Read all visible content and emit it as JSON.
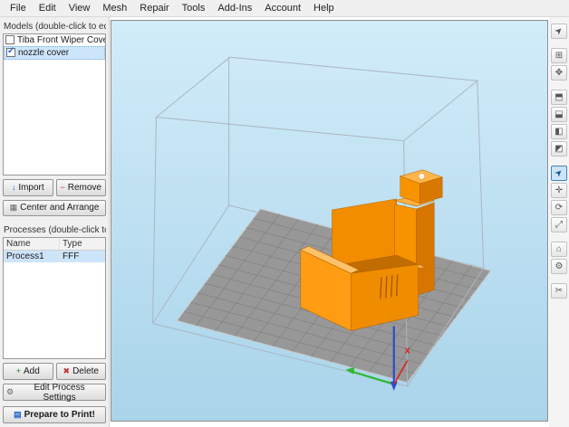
{
  "menu": {
    "items": [
      "File",
      "Edit",
      "View",
      "Mesh",
      "Repair",
      "Tools",
      "Add-Ins",
      "Account",
      "Help"
    ]
  },
  "models_panel": {
    "title": "Models (double-click to edit)",
    "items": [
      {
        "label": "Tiba Front Wiper Cover.STL",
        "checked": false,
        "selected": false
      },
      {
        "label": "nozzle cover",
        "checked": true,
        "selected": true
      }
    ],
    "import_label": "Import",
    "remove_label": "Remove",
    "center_arrange_label": "Center and Arrange"
  },
  "processes_panel": {
    "title": "Processes (double-click to edit)",
    "columns": [
      "Name",
      "Type"
    ],
    "rows": [
      {
        "name": "Process1",
        "type": "FFF"
      }
    ],
    "add_label": "Add",
    "delete_label": "Delete",
    "edit_settings_label": "Edit Process Settings",
    "prepare_label": "Prepare to Print!"
  },
  "viewport": {
    "axis_x_label": "x"
  },
  "toolbar": {
    "icons": [
      {
        "name": "select-arrow-icon",
        "glyph": "➤"
      },
      {
        "name": "fit-view-icon",
        "glyph": "⊞"
      },
      {
        "name": "pan-view-icon",
        "glyph": "✥"
      },
      {
        "name": "cube-top-view-icon",
        "glyph": "⬒"
      },
      {
        "name": "cube-front-view-icon",
        "glyph": "⬓"
      },
      {
        "name": "cube-side-view-icon",
        "glyph": "◧"
      },
      {
        "name": "cube-iso-view-icon",
        "glyph": "◩"
      },
      {
        "name": "cursor-tool-icon",
        "glyph": "➤"
      },
      {
        "name": "move-tool-icon",
        "glyph": "✛"
      },
      {
        "name": "rotate-tool-icon",
        "glyph": "⟳"
      },
      {
        "name": "scale-tool-icon",
        "glyph": "⤢"
      },
      {
        "name": "support-tool-icon",
        "glyph": "⌂"
      },
      {
        "name": "settings-gear-icon",
        "glyph": "⚙"
      },
      {
        "name": "cross-section-icon",
        "glyph": "✂"
      }
    ]
  },
  "colors": {
    "model_orange": "#f79200",
    "plate_gray": "#979797",
    "sky_top": "#d0eaf8",
    "sky_bottom": "#aed8ee",
    "selection_blue": "#cde5fb"
  }
}
